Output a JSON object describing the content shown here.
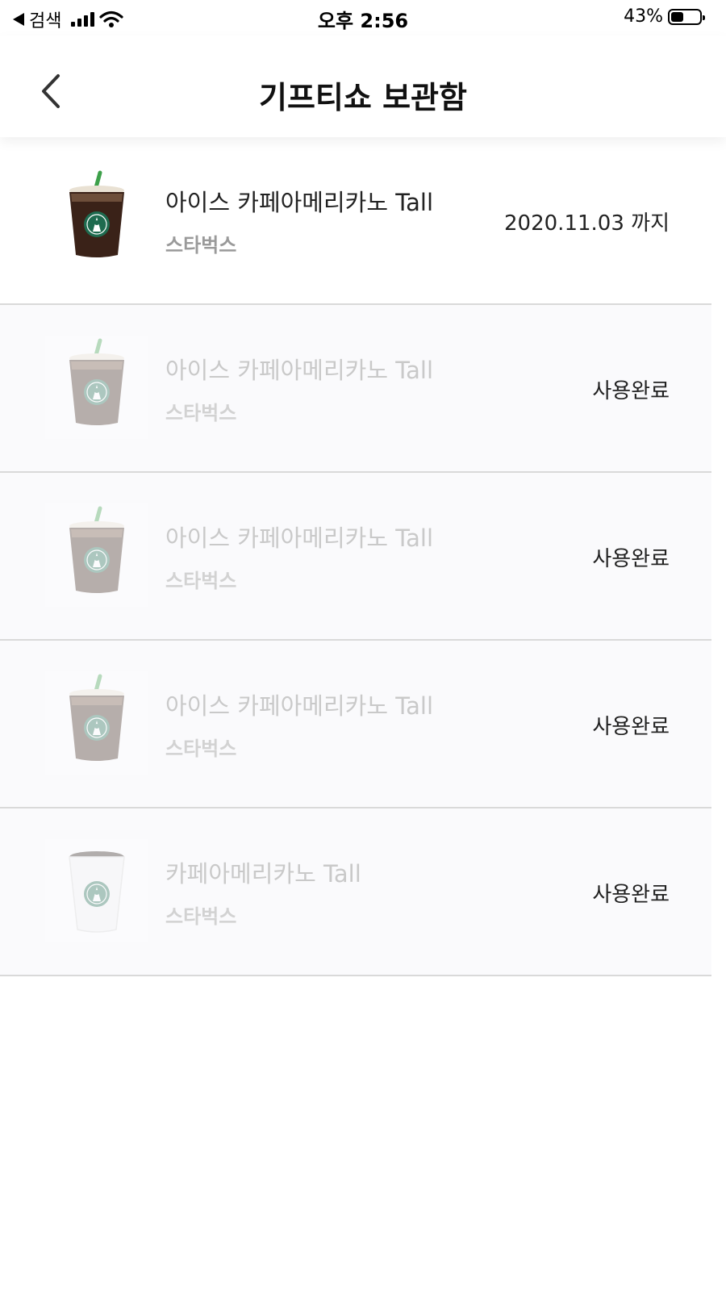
{
  "status_bar": {
    "back_app": "검색",
    "time": "오후 2:56",
    "battery_percent": "43%",
    "battery_level": 0.43
  },
  "nav": {
    "title": "기프티쇼 보관함",
    "back_icon": "chevron-left-icon"
  },
  "gifts": [
    {
      "name": "아이스 카페아메리카노 Tall",
      "brand": "스타벅스",
      "status": "2020.11.03 까지",
      "used": false,
      "image": "iced-coffee-cup-image"
    },
    {
      "name": "아이스 카페아메리카노 Tall",
      "brand": "스타벅스",
      "status": "사용완료",
      "used": true,
      "image": "iced-coffee-cup-image"
    },
    {
      "name": "아이스 카페아메리카노 Tall",
      "brand": "스타벅스",
      "status": "사용완료",
      "used": true,
      "image": "iced-coffee-cup-image"
    },
    {
      "name": "아이스 카페아메리카노 Tall",
      "brand": "스타벅스",
      "status": "사용완료",
      "used": true,
      "image": "iced-coffee-cup-image"
    },
    {
      "name": "카페아메리카노 Tall",
      "brand": "스타벅스",
      "status": "사용완료",
      "used": true,
      "image": "hot-coffee-cup-image"
    }
  ],
  "colors": {
    "logo_green": "#1e6b4f",
    "coffee": "#3a2218",
    "divider": "#d9d9d9"
  }
}
